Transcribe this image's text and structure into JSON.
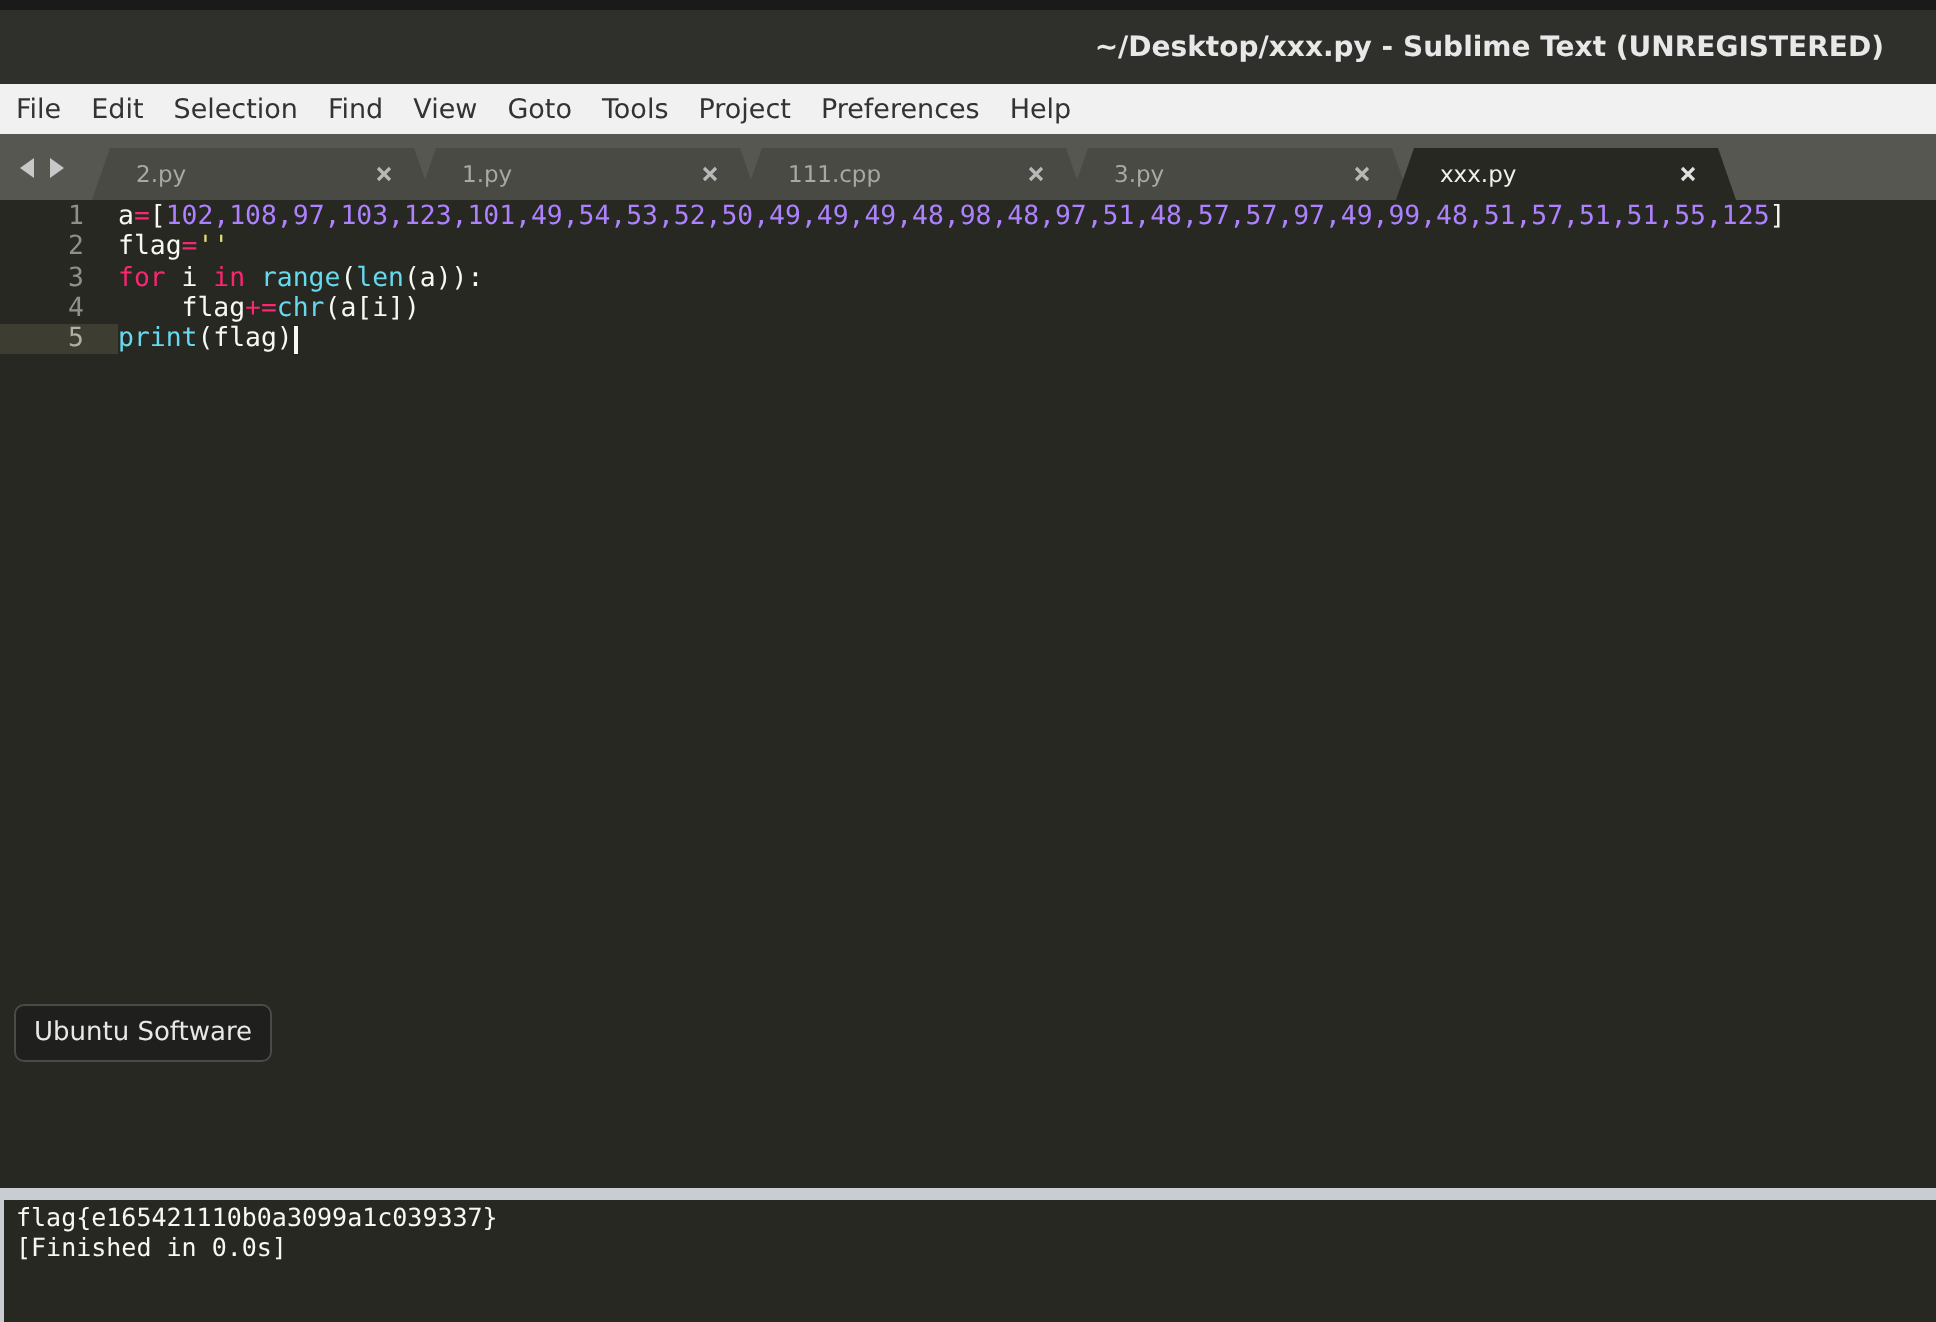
{
  "window": {
    "title": "~/Desktop/xxx.py - Sublime Text (UNREGISTERED)"
  },
  "menu": [
    "File",
    "Edit",
    "Selection",
    "Find",
    "View",
    "Goto",
    "Tools",
    "Project",
    "Preferences",
    "Help"
  ],
  "tabs": [
    {
      "label": "2.py",
      "selected": false
    },
    {
      "label": "1.py",
      "selected": false
    },
    {
      "label": "111.cpp",
      "selected": false
    },
    {
      "label": "3.py",
      "selected": false
    },
    {
      "label": "xxx.py",
      "selected": true
    }
  ],
  "editor": {
    "lines": [
      {
        "number": "1",
        "current": false,
        "tokens": [
          {
            "text": "a",
            "kind": "plain"
          },
          {
            "text": "=",
            "kind": "op"
          },
          {
            "text": "[",
            "kind": "plain"
          },
          {
            "text": "102,108,97,103,123,101,49,54,53,52,50,49,49,49,48,98,48,97,51,48,57,57,97,49,99,48,51,57,51,51,55,125",
            "kind": "num"
          },
          {
            "text": "]",
            "kind": "plain"
          }
        ]
      },
      {
        "number": "2",
        "current": false,
        "tokens": [
          {
            "text": "flag",
            "kind": "plain"
          },
          {
            "text": "=",
            "kind": "op"
          },
          {
            "text": "''",
            "kind": "str"
          }
        ]
      },
      {
        "number": "3",
        "current": false,
        "tokens": [
          {
            "text": "for",
            "kind": "kw"
          },
          {
            "text": " i ",
            "kind": "plain"
          },
          {
            "text": "in",
            "kind": "kw"
          },
          {
            "text": " range",
            "kind": "fn"
          },
          {
            "text": "(",
            "kind": "plain"
          },
          {
            "text": "len",
            "kind": "fn"
          },
          {
            "text": "(a)):",
            "kind": "plain"
          }
        ]
      },
      {
        "number": "4",
        "current": false,
        "tokens": [
          {
            "text": "    flag",
            "kind": "plain"
          },
          {
            "text": "+=",
            "kind": "op"
          },
          {
            "text": "chr",
            "kind": "fn"
          },
          {
            "text": "(a[i])",
            "kind": "plain"
          }
        ]
      },
      {
        "number": "5",
        "current": true,
        "tokens": [
          {
            "text": "print",
            "kind": "fn"
          },
          {
            "text": "(flag)",
            "kind": "plain"
          }
        ]
      }
    ]
  },
  "tooltip": "Ubuntu Software",
  "output": [
    "flag{e165421110b0a3099a1c039337}",
    "[Finished in 0.0s]"
  ]
}
